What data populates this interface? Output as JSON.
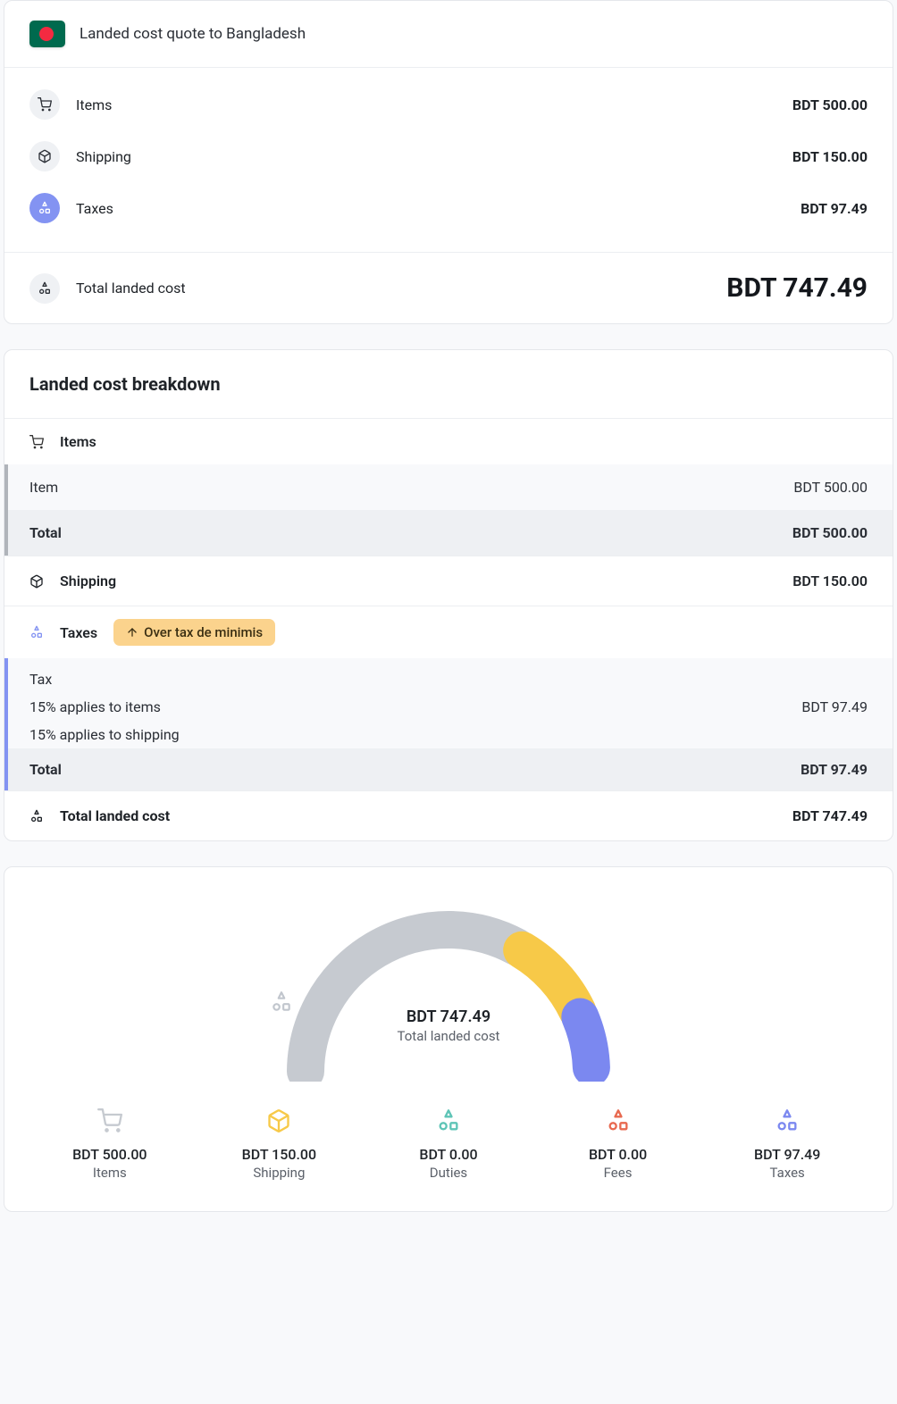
{
  "header": {
    "title": "Landed cost quote to Bangladesh"
  },
  "summary": {
    "items": {
      "label": "Items",
      "value": "BDT 500.00"
    },
    "shipping": {
      "label": "Shipping",
      "value": "BDT 150.00"
    },
    "taxes": {
      "label": "Taxes",
      "value": "BDT 97.49"
    },
    "total": {
      "label": "Total landed cost",
      "value": "BDT 747.49"
    }
  },
  "breakdown": {
    "title": "Landed cost breakdown",
    "items_section": {
      "label": "Items",
      "row_label": "Item",
      "row_value": "BDT 500.00",
      "total_label": "Total",
      "total_value": "BDT 500.00"
    },
    "shipping": {
      "label": "Shipping",
      "value": "BDT 150.00"
    },
    "taxes": {
      "label": "Taxes",
      "badge": "Over tax de minimis",
      "sub_label": "Tax",
      "line1": "15% applies to items",
      "line1_value": "BDT 97.49",
      "line2": "15% applies to shipping",
      "total_label": "Total",
      "total_value": "BDT 97.49"
    },
    "total": {
      "label": "Total landed cost",
      "value": "BDT 747.49"
    }
  },
  "gauge": {
    "amount": "BDT 747.49",
    "sub": "Total landed cost",
    "legend": {
      "items": {
        "amount": "BDT 500.00",
        "label": "Items"
      },
      "shipping": {
        "amount": "BDT 150.00",
        "label": "Shipping"
      },
      "duties": {
        "amount": "BDT 0.00",
        "label": "Duties"
      },
      "fees": {
        "amount": "BDT 0.00",
        "label": "Fees"
      },
      "taxes": {
        "amount": "BDT 97.49",
        "label": "Taxes"
      }
    }
  },
  "chart_data": {
    "type": "pie",
    "title": "Total landed cost",
    "categories": [
      "Items",
      "Shipping",
      "Duties",
      "Fees",
      "Taxes"
    ],
    "values": [
      500.0,
      150.0,
      0.0,
      0.0,
      97.49
    ],
    "currency": "BDT",
    "total": 747.49,
    "colors": [
      "#c6cad0",
      "#f7c948",
      "#5ec4b6",
      "#e8694f",
      "#7b88f0"
    ]
  }
}
